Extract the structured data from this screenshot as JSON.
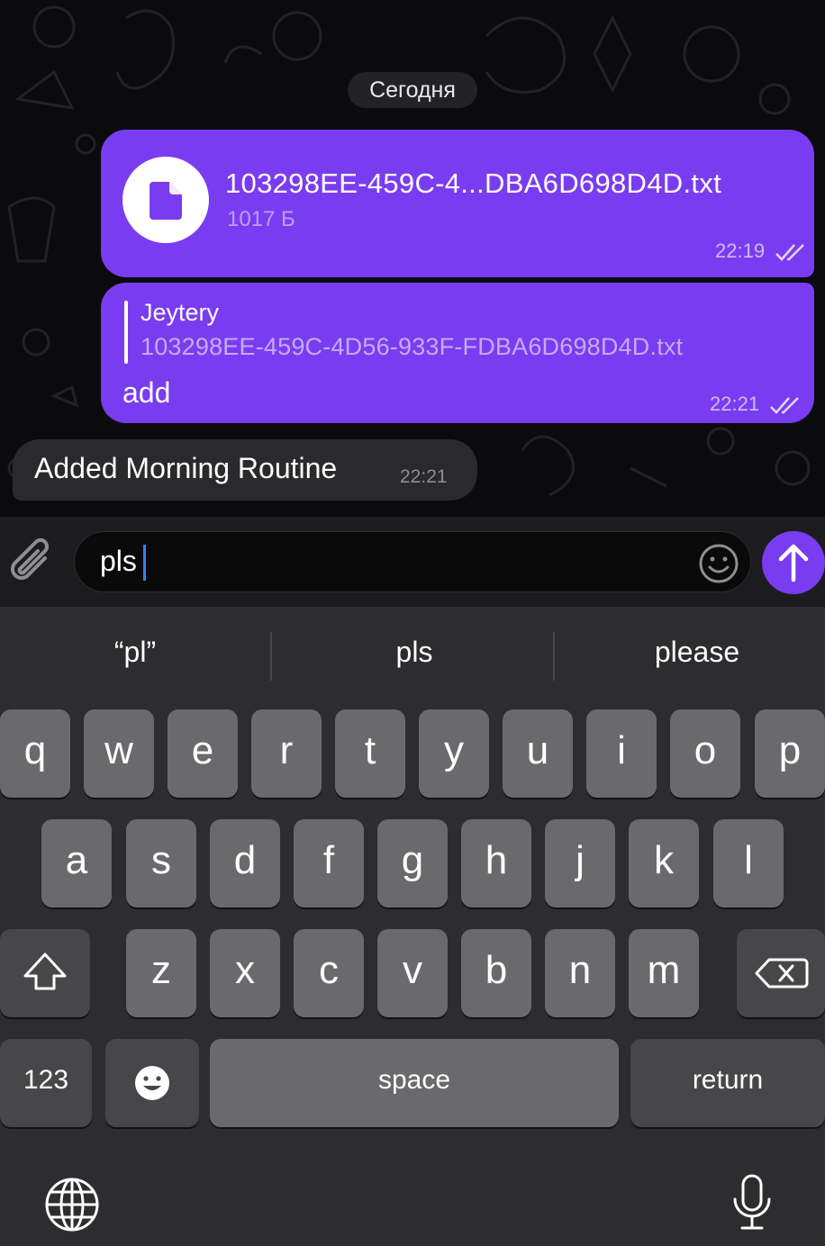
{
  "chat": {
    "date_label": "Сегодня",
    "messages": [
      {
        "type": "file",
        "direction": "outgoing",
        "file_name": "103298EE-459C-4...DBA6D698D4D.txt",
        "file_size": "1017 Б",
        "time": "22:19",
        "status": "read"
      },
      {
        "type": "reply",
        "direction": "outgoing",
        "reply_author": "Jeytery",
        "reply_text": "103298EE-459C-4D56-933F-FDBA6D698D4D.txt",
        "text": "add",
        "time": "22:21",
        "status": "read"
      },
      {
        "type": "text",
        "direction": "incoming",
        "text": "Added Morning Routine",
        "time": "22:21"
      }
    ]
  },
  "composer": {
    "value": "pls",
    "accent_color": "#7a3cf0"
  },
  "keyboard": {
    "suggestions": [
      "“pl”",
      "pls",
      "please"
    ],
    "row1": [
      "q",
      "w",
      "e",
      "r",
      "t",
      "y",
      "u",
      "i",
      "o",
      "p"
    ],
    "row2": [
      "a",
      "s",
      "d",
      "f",
      "g",
      "h",
      "j",
      "k",
      "l"
    ],
    "row3": [
      "z",
      "x",
      "c",
      "v",
      "b",
      "n",
      "m"
    ],
    "numbers_label": "123",
    "space_label": "space",
    "return_label": "return"
  },
  "icons": [
    "file-icon",
    "read-checks-icon",
    "paperclip-icon",
    "emoji-icon",
    "send-arrow-icon",
    "shift-icon",
    "backspace-icon",
    "emoji-keyboard-icon",
    "globe-icon",
    "microphone-icon"
  ]
}
